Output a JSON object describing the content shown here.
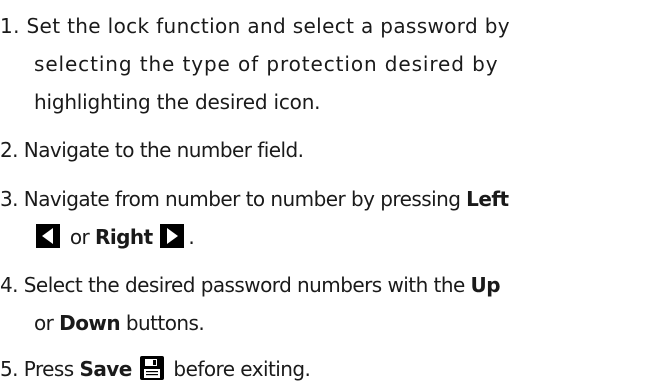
{
  "steps": [
    {
      "lines": [
        "1. Set the lock function and select a password by",
        "selecting the type of protection desired by",
        "highlighting the desired icon."
      ]
    },
    {
      "text": "2. Navigate to the number field."
    },
    {
      "prefix": "3. Navigate from number to number by pressing ",
      "left_label": "Left",
      "or_text": "or",
      "right_label": "Right",
      "suffix": "."
    },
    {
      "prefix": "4. Select the desired password numbers with the ",
      "up_label": "Up",
      "or_text": "or",
      "down_label": "Down",
      "suffix": "buttons."
    },
    {
      "prefix": "5. Press ",
      "save_label": "Save",
      "suffix": "before exiting."
    }
  ],
  "icons": {
    "left": "left-arrow-icon",
    "right": "right-arrow-icon",
    "save": "save-floppy-icon"
  },
  "colors": {
    "text": "#1a1a1a",
    "icon_fill": "#000000"
  }
}
